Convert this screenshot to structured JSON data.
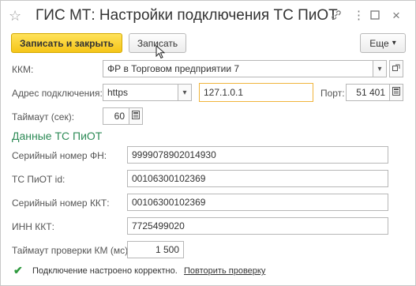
{
  "window": {
    "title": "ГИС МТ: Настройки подключения ТС ПиОТ"
  },
  "toolbar": {
    "save_close_label": "Записать и закрыть",
    "save_label": "Записать",
    "more_label": "Еще",
    "more_arrow": "▾"
  },
  "form": {
    "kkm_label": "ККМ:",
    "kkm_value": "ФР в Торговом предприятии 7",
    "address_label": "Адрес подключения:",
    "protocol_value": "https",
    "host_value": "127.1.0.1",
    "port_label": "Порт:",
    "port_value": "51 401",
    "timeout_label": "Таймаут (сек):",
    "timeout_value": "60"
  },
  "section": {
    "title": "Данные ТС ПиОТ",
    "fn_label": "Серийный номер ФН:",
    "fn_value": "9999078902014930",
    "id_label": "ТС ПиОТ id:",
    "id_value": "00106300102369",
    "kkt_serial_label": "Серийный номер ККТ:",
    "kkt_serial_value": "00106300102369",
    "inn_label": "ИНН ККТ:",
    "inn_value": "7725499020",
    "km_timeout_label": "Таймаут проверки КМ (мс):",
    "km_timeout_value": "1 500"
  },
  "status": {
    "text": "Подключение настроено корректно.",
    "link": "Повторить проверку"
  },
  "icons": {
    "star": "star-icon",
    "link": "link-icon",
    "menu": "more-icon",
    "maximize": "maximize-icon",
    "close": "close-icon"
  }
}
